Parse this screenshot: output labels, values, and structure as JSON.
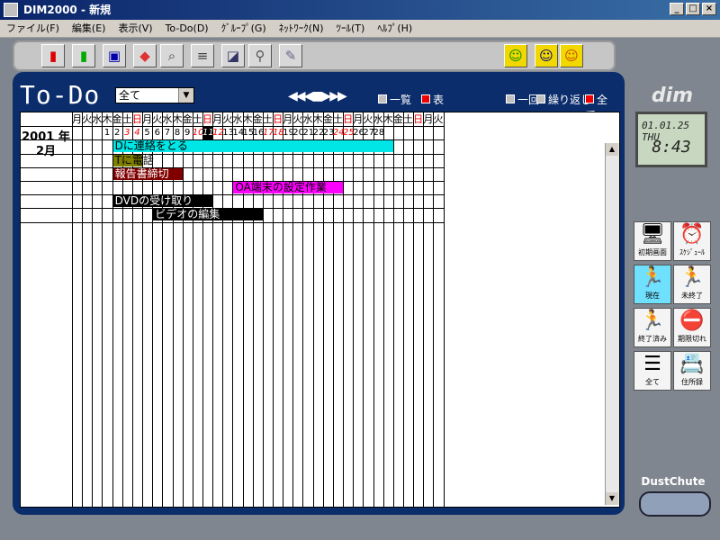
{
  "window": {
    "title": "DIM2000 - 新規"
  },
  "menu": [
    "ファイル(F)",
    "編集(E)",
    "表示(V)",
    "To-Do(D)",
    "ｸﾞﾙｰﾌﾟ(G)",
    "ﾈｯﾄﾜｰｸ(N)",
    "ﾂｰﾙ(T)",
    "ﾍﾙﾌﾟ(H)"
  ],
  "toolbar": {
    "icons": [
      "new-red-icon",
      "new-green-icon",
      "save-icon",
      "eraser-icon",
      "search-icon",
      "notes-icon",
      "import-icon",
      "pin-icon",
      "pen-icon",
      "user-green-icon",
      "user-yellow-icon",
      "user-orange-icon"
    ]
  },
  "header": {
    "title": "To-Do",
    "filter_value": "全て",
    "nav": "◀◀◀■▶▶▶",
    "view_list": "一覧",
    "view_table": "表",
    "once": "一回",
    "repeat": "繰り返し",
    "all": "全て"
  },
  "calendar": {
    "year": "2001 年",
    "month": "2月",
    "weekdays": [
      "月",
      "火",
      "水",
      "木",
      "金",
      "土",
      "日",
      "月",
      "火",
      "水",
      "木",
      "金",
      "土",
      "日",
      "月",
      "火",
      "水",
      "木",
      "金",
      "土",
      "日",
      "月",
      "火",
      "水",
      "木",
      "金",
      "土",
      "日",
      "月",
      "火",
      "水",
      "木",
      "金",
      "土",
      "日",
      "月",
      "火"
    ],
    "days": [
      "",
      "",
      "",
      "1",
      "2",
      "3",
      "4",
      "5",
      "6",
      "7",
      "8",
      "9",
      "10",
      "11",
      "12",
      "13",
      "14",
      "15",
      "16",
      "17",
      "18",
      "19",
      "20",
      "21",
      "22",
      "23",
      "24",
      "25",
      "26",
      "27",
      "28",
      "",
      "",
      "",
      "",
      "",
      ""
    ],
    "red_days": [
      "3",
      "4",
      "10",
      "11",
      "12",
      "17",
      "18",
      "24",
      "25"
    ],
    "today": "11"
  },
  "tasks": [
    {
      "label": "Dに連絡をとる",
      "color": "#00e5e5",
      "text_color": "#000000",
      "start": 4,
      "end": 31
    },
    {
      "label": "Tに電話",
      "color": "#808000",
      "text_color": "#000000",
      "start": 4,
      "end": 6
    },
    {
      "label": "報告書締切",
      "color": "#800000",
      "text_color": "#ffffff",
      "start": 4,
      "end": 10
    },
    {
      "label": "OA端末の設定作業",
      "color": "#ff00ff",
      "text_color": "#000000",
      "start": 16,
      "end": 26
    },
    {
      "label": "DVDの受け取り",
      "color": "#000000",
      "text_color": "#ffffff",
      "start": 4,
      "end": 13
    },
    {
      "label": "ビデオの編集",
      "color": "#000000",
      "text_color": "#ffffff",
      "start": 8,
      "end": 18
    }
  ],
  "right_panel": {
    "logo": "dim",
    "clock_date": "01.01.25 THU",
    "clock_time": "8:43",
    "buttons": [
      {
        "label": "初期画面",
        "icon": "monitor-icon",
        "on": false
      },
      {
        "label": "ｽｹｼﾞｭｰﾙ",
        "icon": "schedule-icon",
        "on": false
      },
      {
        "label": "現在",
        "icon": "running-man-icon",
        "on": true
      },
      {
        "label": "未終了",
        "icon": "running-man-yellow-icon",
        "on": false
      },
      {
        "label": "終了済み",
        "icon": "runner-finished-icon",
        "on": false
      },
      {
        "label": "期限切れ",
        "icon": "expired-icon",
        "on": false
      },
      {
        "label": "全て",
        "icon": "all-icon",
        "on": false
      },
      {
        "label": "住所録",
        "icon": "address-book-icon",
        "on": false
      }
    ],
    "dust": "DustChute"
  }
}
